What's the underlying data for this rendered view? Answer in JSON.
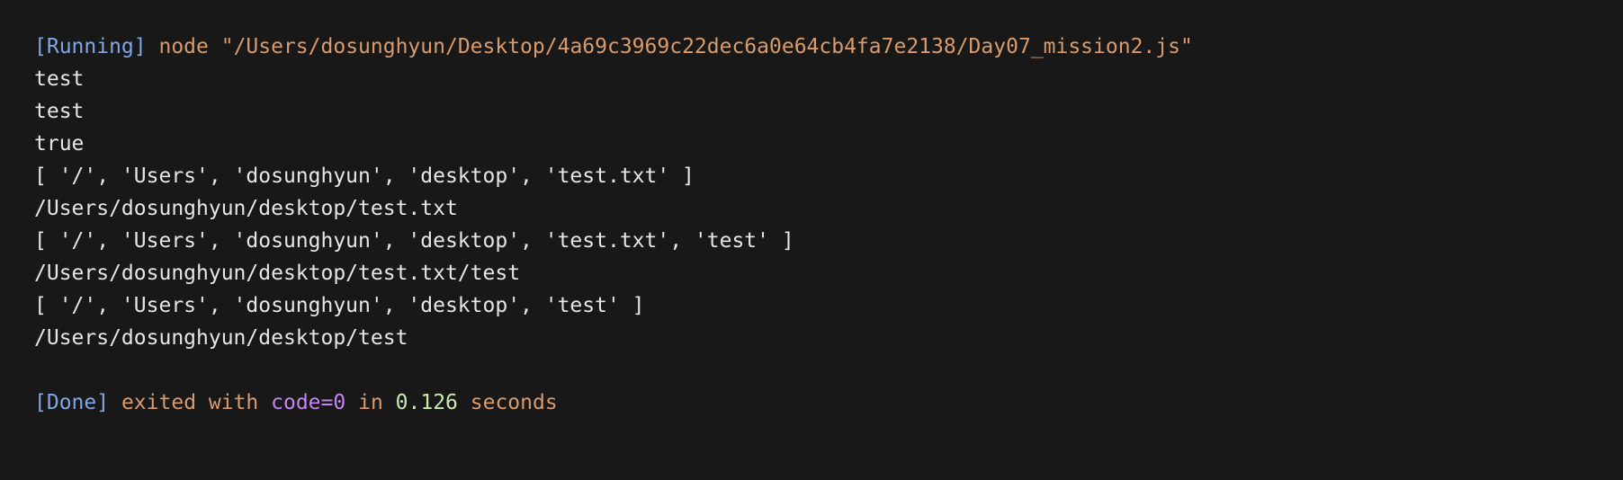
{
  "run_header": {
    "tag": "[Running]",
    "command": "node \"/Users/dosunghyun/Desktop/4a69c3969c22dec6a0e64cb4fa7e2138/Day07_mission2.js\""
  },
  "output_lines": [
    "test",
    "test",
    "true",
    "[ '/', 'Users', 'dosunghyun', 'desktop', 'test.txt' ]",
    "/Users/dosunghyun/desktop/test.txt",
    "[ '/', 'Users', 'dosunghyun', 'desktop', 'test.txt', 'test' ]",
    "/Users/dosunghyun/desktop/test.txt/test",
    "[ '/', 'Users', 'dosunghyun', 'desktop', 'test' ]",
    "/Users/dosunghyun/desktop/test"
  ],
  "done_footer": {
    "tag": "[Done]",
    "exited_with": "exited with",
    "code": "code=0",
    "in": "in",
    "seconds_value": "0.126",
    "seconds_label": "seconds"
  }
}
